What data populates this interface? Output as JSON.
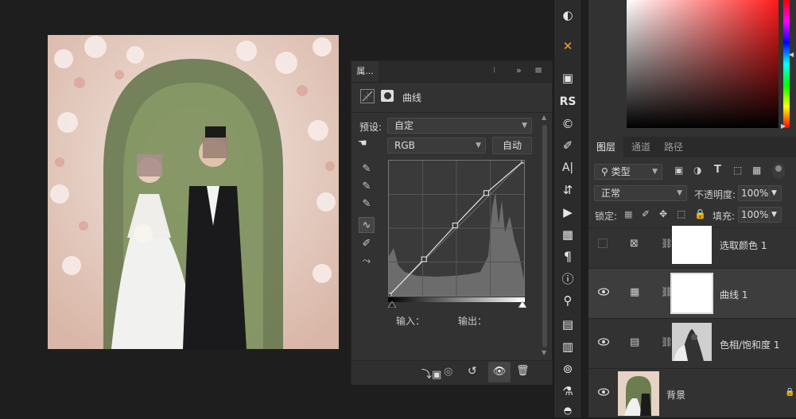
{
  "properties": {
    "tab_label": "属...",
    "header_title": "曲线",
    "preset_label": "预设:",
    "preset_value": "自定",
    "channel_value": "RGB",
    "auto_button": "自动",
    "input_label": "输入：",
    "output_label": "输出：",
    "curve_points": [
      [
        0,
        0
      ],
      [
        0.26,
        0.27
      ],
      [
        0.49,
        0.52
      ],
      [
        0.72,
        0.76
      ],
      [
        1,
        1
      ]
    ]
  },
  "layers_panel": {
    "tabs": [
      "图层",
      "通道",
      "路径"
    ],
    "filter_kind": "类型",
    "blend_mode": "正常",
    "opacity_label": "不透明度:",
    "opacity_value": "100%",
    "lock_label": "锁定:",
    "fill_label": "填充:",
    "fill_value": "100%",
    "layers": [
      {
        "name": "选取颜色 1",
        "visible": false,
        "selected": false
      },
      {
        "name": "曲线 1",
        "visible": true,
        "selected": true
      },
      {
        "name": "色相/饱和度 1",
        "visible": true,
        "selected": false
      },
      {
        "name": "背景",
        "visible": true,
        "selected": false
      }
    ]
  },
  "toolbar_strip": {
    "rs_label": "RS",
    "text_tool_label": "A|",
    "paragraph_label": "¶"
  },
  "colors": {
    "panel_bg": "#323232",
    "dark_bg": "#1e1e1e",
    "selected_row": "#3d3d3d"
  }
}
